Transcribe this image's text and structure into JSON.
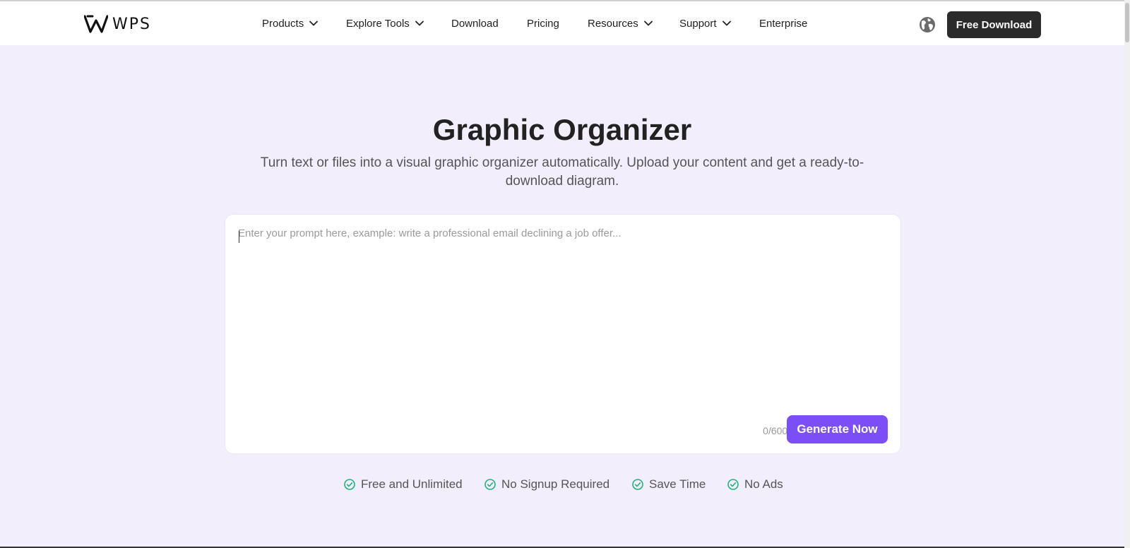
{
  "brand": {
    "logo_text": "WPS"
  },
  "nav": {
    "items": [
      {
        "label": "Products",
        "dropdown": true
      },
      {
        "label": "Explore Tools",
        "dropdown": true
      },
      {
        "label": "Download",
        "dropdown": false
      },
      {
        "label": "Pricing",
        "dropdown": false
      },
      {
        "label": "Resources",
        "dropdown": true
      },
      {
        "label": "Support",
        "dropdown": true
      },
      {
        "label": "Enterprise",
        "dropdown": false
      }
    ],
    "language_icon": "globe-icon",
    "cta_label": "Free Download"
  },
  "hero": {
    "title": "Graphic Organizer",
    "subtitle": "Turn text or files into a visual graphic organizer automatically. Upload your content and get a ready-to-download diagram."
  },
  "prompt": {
    "value": "",
    "placeholder": "Enter your prompt here, example: write a professional email declining a job offer...",
    "counter": "0/6000",
    "submit_label": "Generate Now"
  },
  "features": [
    {
      "label": "Free and Unlimited",
      "icon": "check-circle-icon"
    },
    {
      "label": "No Signup Required",
      "icon": "check-circle-icon"
    },
    {
      "label": "Save Time",
      "icon": "check-circle-icon"
    },
    {
      "label": "No Ads",
      "icon": "check-circle-icon"
    }
  ],
  "colors": {
    "page_background": "#f2eefc",
    "accent": "#7b4ff5",
    "cta_dark": "#2b2b2b",
    "check_green": "#1fb37a"
  }
}
